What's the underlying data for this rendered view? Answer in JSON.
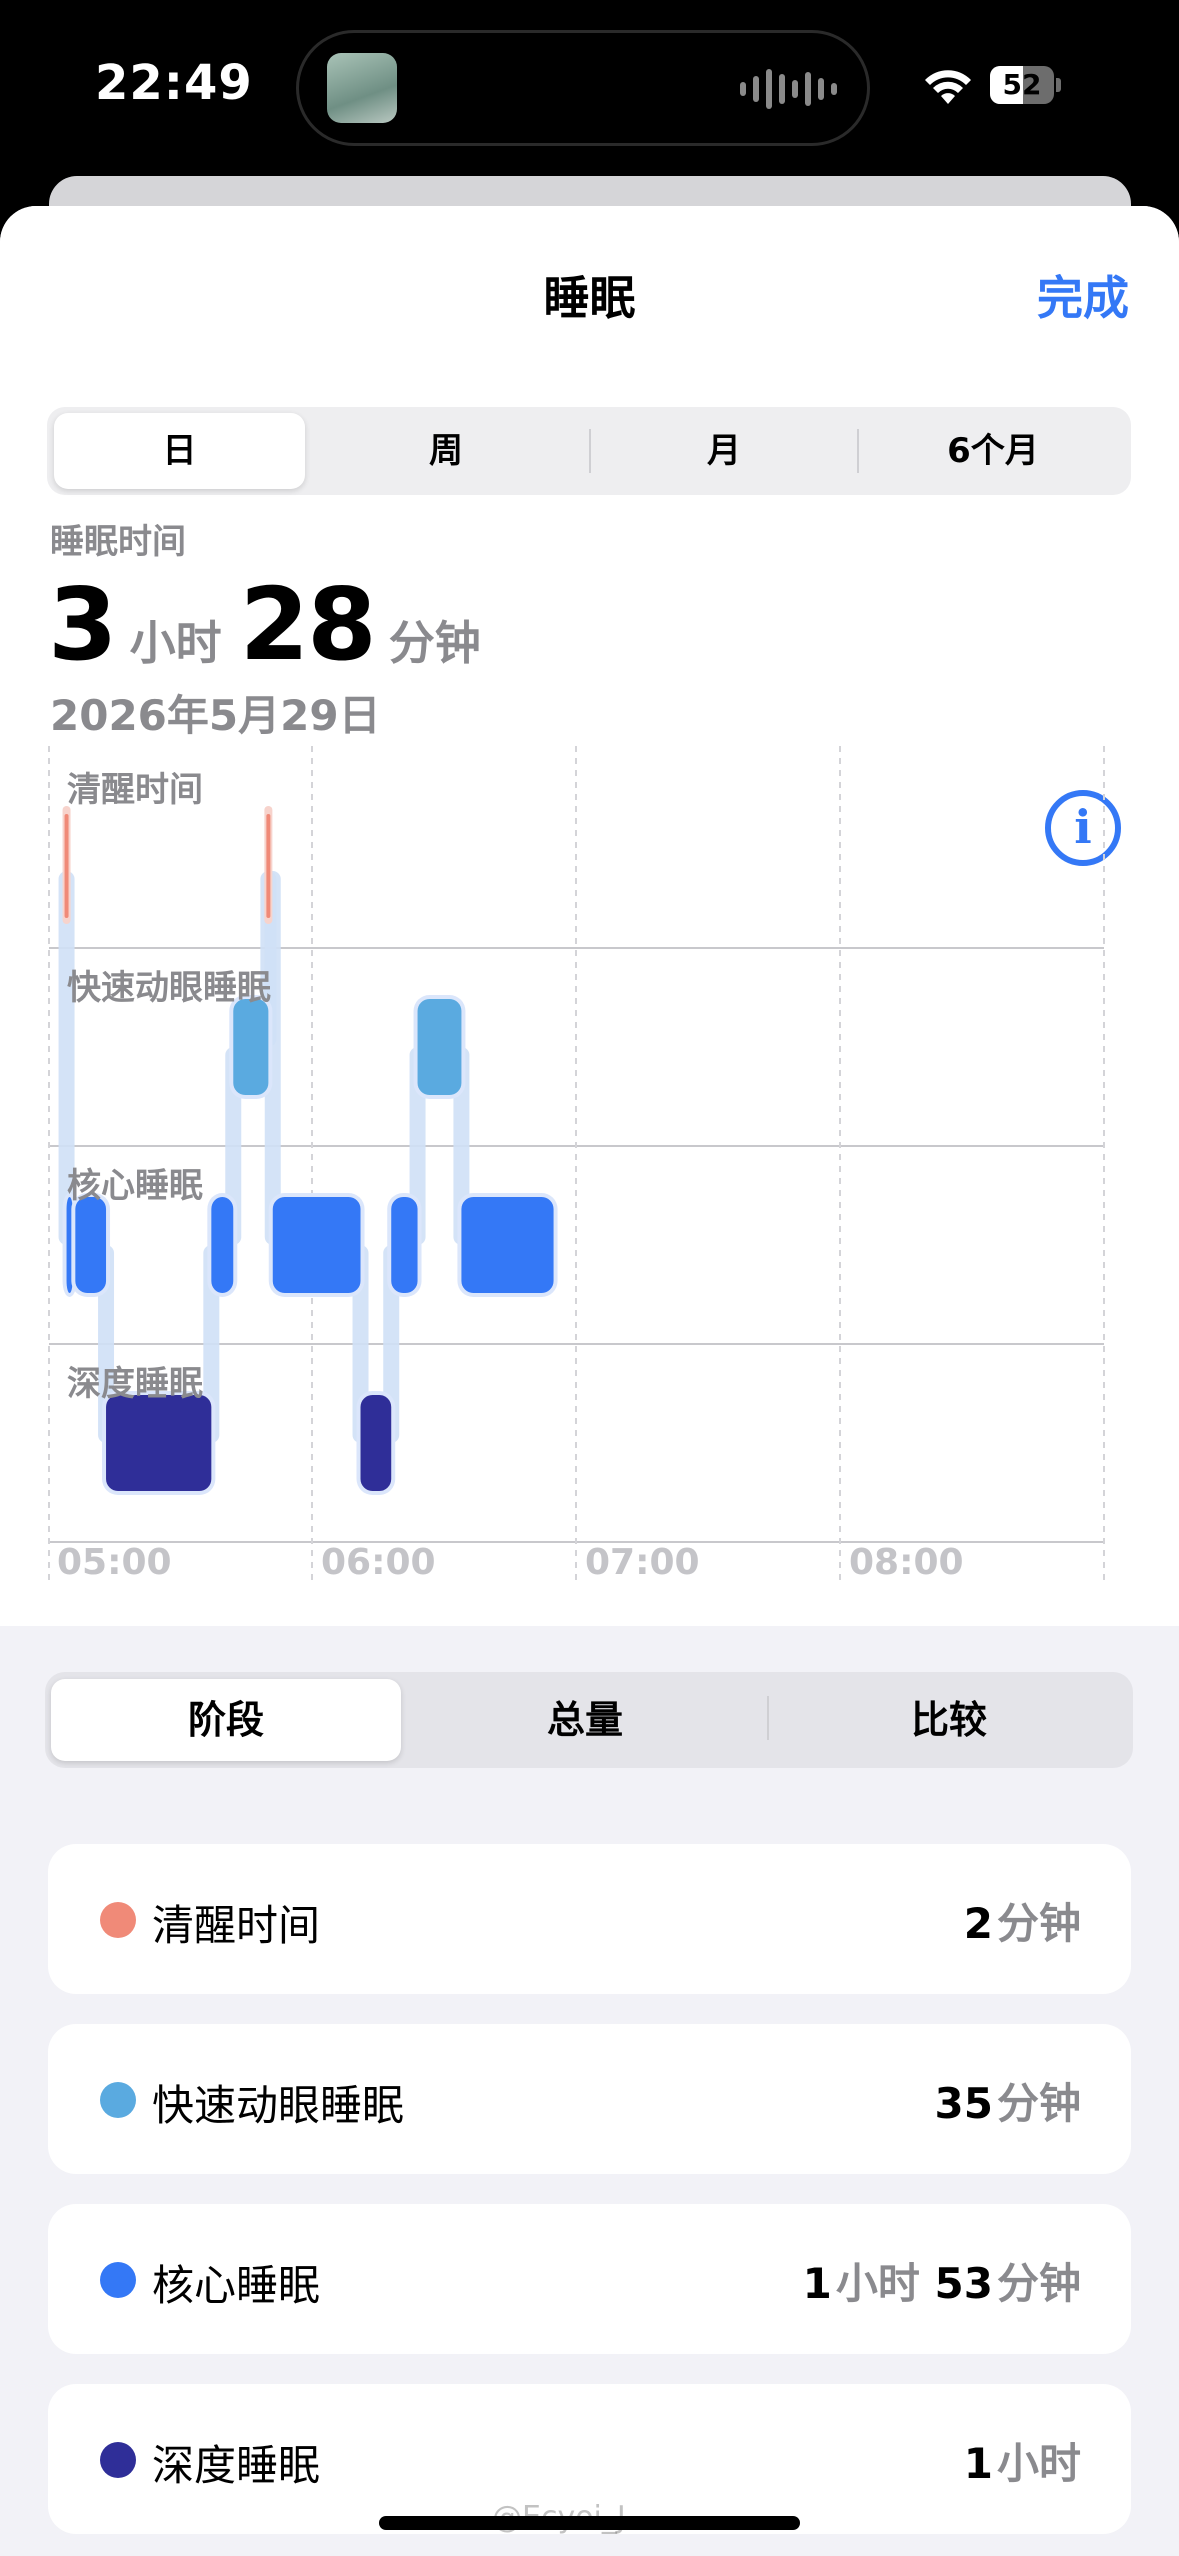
{
  "status_bar": {
    "time": "22:49",
    "battery": "52",
    "battery_level": 0.52
  },
  "nav": {
    "title": "睡眠",
    "done": "完成"
  },
  "range_tabs": [
    {
      "label": "日"
    },
    {
      "label": "周"
    },
    {
      "label": "月"
    },
    {
      "label": "6个月"
    }
  ],
  "summary": {
    "label": "睡眠时间",
    "hours": "3",
    "hours_unit": "小时",
    "minutes": "28",
    "minutes_unit": "分钟",
    "date": "2026年5月29日"
  },
  "chart": {
    "stage_labels": [
      "清醒时间",
      "快速动眼睡眠",
      "核心睡眠",
      "深度睡眠"
    ],
    "x_ticks": [
      "05:00",
      "06:00",
      "07:00",
      "08:00"
    ]
  },
  "chart_data": {
    "type": "timeline",
    "x_start": "04:56",
    "x_end": "08:56",
    "colors": {
      "awake": "#f08a78",
      "rem": "#5aaae0",
      "core": "#3478f6",
      "deep": "#2f2e98"
    },
    "segments": [
      {
        "stage": "awake",
        "start": "05:00",
        "end": "05:01"
      },
      {
        "stage": "core",
        "start": "05:00",
        "end": "05:01"
      },
      {
        "stage": "core",
        "start": "05:02",
        "end": "05:09"
      },
      {
        "stage": "deep",
        "start": "05:09",
        "end": "05:33"
      },
      {
        "stage": "core",
        "start": "05:33",
        "end": "05:38"
      },
      {
        "stage": "rem",
        "start": "05:38",
        "end": "05:46"
      },
      {
        "stage": "awake",
        "start": "05:46",
        "end": "05:47"
      },
      {
        "stage": "core",
        "start": "05:47",
        "end": "06:07"
      },
      {
        "stage": "deep",
        "start": "06:07",
        "end": "06:14"
      },
      {
        "stage": "core",
        "start": "06:14",
        "end": "06:20"
      },
      {
        "stage": "rem",
        "start": "06:20",
        "end": "06:30"
      },
      {
        "stage": "core",
        "start": "06:30",
        "end": "06:51"
      }
    ]
  },
  "view_tabs": [
    {
      "label": "阶段"
    },
    {
      "label": "总量"
    },
    {
      "label": "比较"
    }
  ],
  "stages": [
    {
      "name": "清醒时间",
      "color": "#f08a78",
      "value_parts": [
        [
          "2",
          "分钟"
        ]
      ]
    },
    {
      "name": "快速动眼睡眠",
      "color": "#5aaae0",
      "value_parts": [
        [
          "35",
          "分钟"
        ]
      ]
    },
    {
      "name": "核心睡眠",
      "color": "#3478f6",
      "value_parts": [
        [
          "1",
          "小时"
        ],
        [
          "53",
          "分钟"
        ]
      ]
    },
    {
      "name": "深度睡眠",
      "color": "#2f2e98",
      "value_parts": [
        [
          "1",
          "小时"
        ]
      ]
    }
  ],
  "watermark": "@Ecyoi_J"
}
